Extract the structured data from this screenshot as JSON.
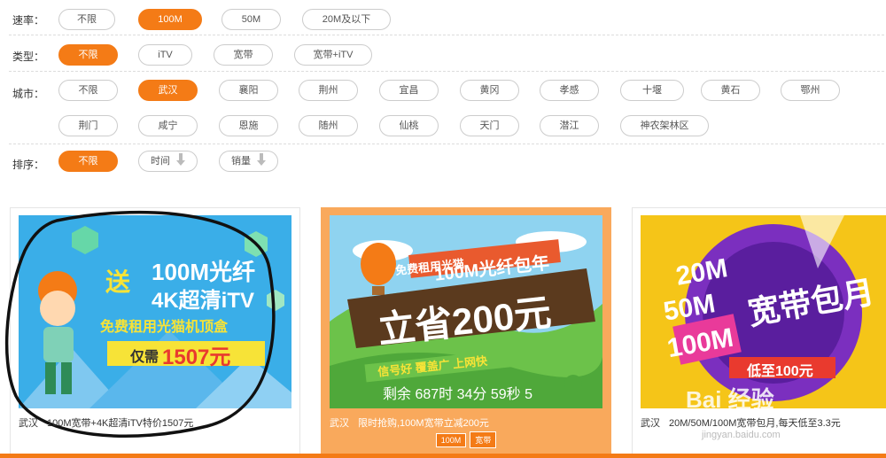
{
  "filters": {
    "speed": {
      "label": "速率：",
      "options": [
        "不限",
        "100M",
        "50M",
        "20M及以下"
      ],
      "selected": "100M"
    },
    "type": {
      "label": "类型：",
      "options": [
        "不限",
        "iTV",
        "宽带",
        "宽带+iTV"
      ],
      "selected": "不限"
    },
    "city": {
      "label": "城市：",
      "options": [
        "不限",
        "武汉",
        "襄阳",
        "荆州",
        "宜昌",
        "黄冈",
        "孝感",
        "十堰",
        "黄石",
        "鄂州",
        "荆门",
        "咸宁",
        "恩施",
        "随州",
        "仙桃",
        "天门",
        "潜江",
        "神农架林区"
      ],
      "selected": "武汉"
    },
    "sort": {
      "label": "排序：",
      "options": [
        "不限",
        "时间",
        "销量"
      ],
      "selected": "不限"
    }
  },
  "products": [
    {
      "city": "武汉",
      "title": "100M宽带+4K超清iTV特价1507元",
      "banner": {
        "badge": "送",
        "line1": "100M光纤",
        "line2": "4K超清iTV",
        "line3": "免费租用光猫机顶盒",
        "price_prefix": "仅需",
        "price": "1507元"
      }
    },
    {
      "city": "武汉",
      "title": "限时抢购,100M宽带立减200元",
      "banner": {
        "ribbon": "免费租用光猫",
        "line1": "100M光纤包年",
        "line2": "立省200元",
        "line3": "信号好 覆盖广 上网快",
        "countdown": "剩余 687时 34分 59秒 5"
      },
      "tags": [
        "100M",
        "宽带"
      ]
    },
    {
      "city": "武汉",
      "title": "20M/50M/100M宽带包月,每天低至3.3元",
      "banner": {
        "speeds": [
          "20M",
          "50M",
          "100M"
        ],
        "headline": "宽带包月",
        "price_tag": "低至100元",
        "watermark": "Bai 经验",
        "watermark_url": "jingyan.baidu.com"
      }
    }
  ],
  "colors": {
    "accent": "#f47b16",
    "card_highlight": "#f9a95c"
  }
}
